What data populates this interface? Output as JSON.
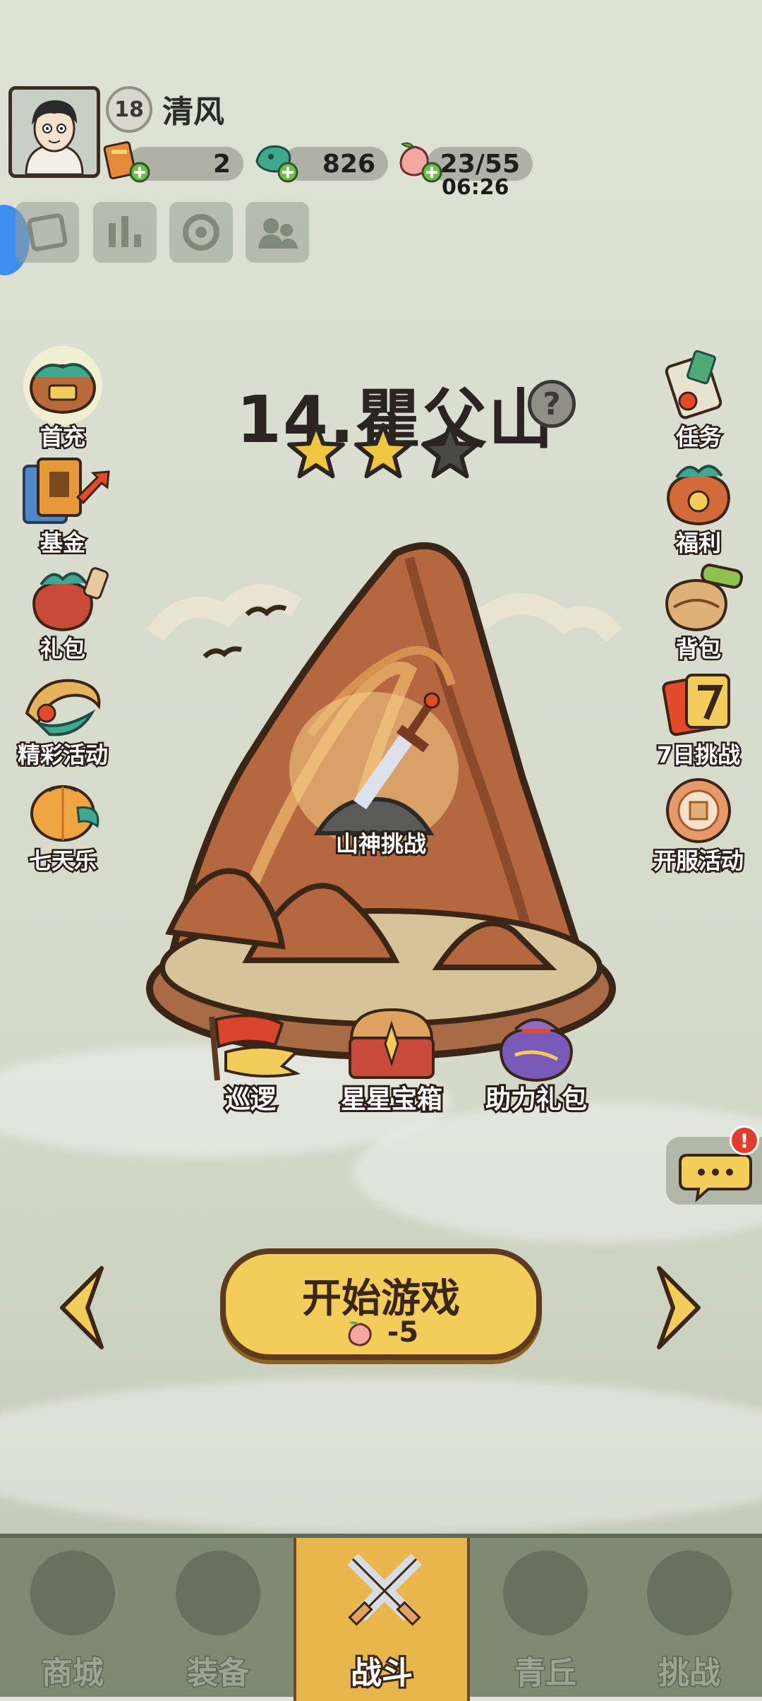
{
  "player": {
    "level": "18",
    "name": "清风"
  },
  "resources": [
    {
      "name": "scroll",
      "value": "2"
    },
    {
      "name": "jade",
      "value": "826"
    },
    {
      "name": "peach-stamina",
      "value": "23/55"
    }
  ],
  "stamina_timer": "06:26",
  "left_menu": [
    "首充",
    "基金",
    "礼包",
    "精彩活动",
    "七天乐"
  ],
  "right_menu": [
    "任务",
    "福利",
    "背包",
    "7日挑战",
    "开服活动"
  ],
  "stage": {
    "title": "14.瞿父山",
    "stars_earned": 2,
    "stars_total": 3,
    "boss_label": "山神挑战"
  },
  "stage_actions": [
    "巡逻",
    "星星宝箱",
    "助力礼包"
  ],
  "start_button": {
    "label": "开始游戏",
    "cost": "-5"
  },
  "chat_alert": "!",
  "nav": {
    "tabs": [
      "商城",
      "装备",
      "战斗",
      "青丘",
      "挑战"
    ],
    "active": "战斗"
  },
  "colors": {
    "accent": "#f2cd5a",
    "mountain": "#b5673f",
    "active_tab": "#e8b64a",
    "star": "#f0c640"
  }
}
